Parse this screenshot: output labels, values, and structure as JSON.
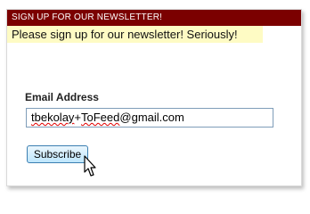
{
  "newsletter": {
    "title": "SIGN UP FOR OUR NEWSLETTER!",
    "notice": "Please sign up for our newsletter! Seriously!",
    "email_label": "Email Address",
    "email_value_parts": [
      "tbekolay",
      "+",
      "ToFeed",
      "@gmail.com"
    ],
    "email_value": "tbekolay+ToFeed@gmail.com",
    "subscribe_label": "Subscribe"
  },
  "colors": {
    "title_bar": "#7b0000",
    "notice_bg": "#fefbc4",
    "button_border": "#3c7fb1"
  }
}
